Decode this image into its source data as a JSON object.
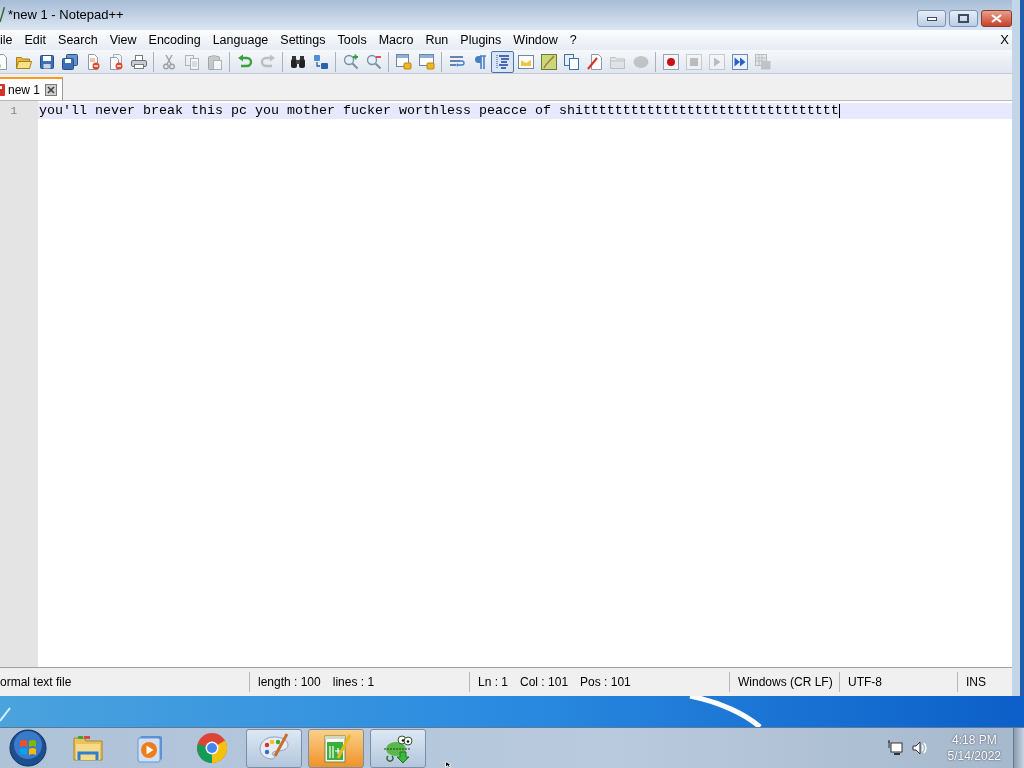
{
  "window": {
    "title": "*new 1 - Notepad++"
  },
  "menu": {
    "items": [
      "ile",
      "Edit",
      "Search",
      "View",
      "Encoding",
      "Language",
      "Settings",
      "Tools",
      "Macro",
      "Run",
      "Plugins",
      "Window",
      "?"
    ],
    "close_label": "X"
  },
  "toolbar": [
    {
      "kind": "new",
      "disabled": false,
      "pressed": false
    },
    {
      "kind": "open",
      "disabled": false,
      "pressed": false
    },
    {
      "kind": "save",
      "disabled": false,
      "pressed": false
    },
    {
      "kind": "saveall",
      "disabled": false,
      "pressed": false
    },
    {
      "kind": "close",
      "disabled": false,
      "pressed": false
    },
    {
      "kind": "closeall",
      "disabled": false,
      "pressed": false
    },
    {
      "kind": "print",
      "disabled": false,
      "pressed": false
    },
    {
      "kind": "separator"
    },
    {
      "kind": "cut",
      "disabled": true,
      "pressed": false
    },
    {
      "kind": "copy",
      "disabled": true,
      "pressed": false
    },
    {
      "kind": "paste",
      "disabled": true,
      "pressed": false
    },
    {
      "kind": "separator"
    },
    {
      "kind": "undo",
      "disabled": false,
      "pressed": false
    },
    {
      "kind": "redo",
      "disabled": true,
      "pressed": false
    },
    {
      "kind": "separator"
    },
    {
      "kind": "find",
      "disabled": false,
      "pressed": false
    },
    {
      "kind": "replace",
      "disabled": false,
      "pressed": false
    },
    {
      "kind": "separator"
    },
    {
      "kind": "zoomin",
      "disabled": false,
      "pressed": false
    },
    {
      "kind": "zoomout",
      "disabled": false,
      "pressed": false
    },
    {
      "kind": "separator"
    },
    {
      "kind": "syncv",
      "disabled": false,
      "pressed": false
    },
    {
      "kind": "synch",
      "disabled": false,
      "pressed": false
    },
    {
      "kind": "separator"
    },
    {
      "kind": "wrap",
      "disabled": false,
      "pressed": false
    },
    {
      "kind": "allchars",
      "disabled": false,
      "pressed": false
    },
    {
      "kind": "indent",
      "disabled": false,
      "pressed": true
    },
    {
      "kind": "udl",
      "disabled": false,
      "pressed": false
    },
    {
      "kind": "docmap",
      "disabled": false,
      "pressed": false
    },
    {
      "kind": "doclist",
      "disabled": false,
      "pressed": false
    },
    {
      "kind": "funclist",
      "disabled": false,
      "pressed": false
    },
    {
      "kind": "folder",
      "disabled": true,
      "pressed": false
    },
    {
      "kind": "monitor",
      "disabled": true,
      "pressed": false
    },
    {
      "kind": "separator"
    },
    {
      "kind": "record",
      "disabled": false,
      "pressed": false
    },
    {
      "kind": "stop",
      "disabled": true,
      "pressed": false
    },
    {
      "kind": "play",
      "disabled": true,
      "pressed": false
    },
    {
      "kind": "playmulti",
      "disabled": false,
      "pressed": false
    },
    {
      "kind": "savemacro",
      "disabled": true,
      "pressed": false
    }
  ],
  "tabs": [
    {
      "label": "new 1",
      "selected": true,
      "unsaved": true
    }
  ],
  "editor": {
    "lines": [
      {
        "number": "1",
        "text": "you'll never break this pc you mother fucker worthless peacce of shitttttttttttttttttttttttttttttttt",
        "current": true
      }
    ]
  },
  "status_bar": [
    {
      "texts": [
        "ormal text file"
      ]
    },
    {
      "texts": [
        "length : 100",
        "lines : 1"
      ]
    },
    {
      "texts": [
        "Ln : 1",
        "Col : 101",
        "Pos : 101"
      ]
    },
    {
      "texts": [
        "Windows (CR LF)"
      ]
    },
    {
      "texts": [
        "UTF-8"
      ]
    },
    {
      "texts": [
        "INS"
      ]
    }
  ],
  "taskbar": {
    "items": [
      {
        "kind": "explorer",
        "open": false,
        "selected": false
      },
      {
        "kind": "media",
        "open": false,
        "selected": false
      },
      {
        "kind": "browser",
        "open": false,
        "selected": false
      },
      {
        "kind": "paint",
        "open": true,
        "selected": false
      },
      {
        "kind": "notepad",
        "open": true,
        "selected": true
      },
      {
        "kind": "chameleon",
        "open": true,
        "selected": false
      }
    ],
    "clock": {
      "time": "4:18 PM",
      "date": "5/14/2022"
    }
  }
}
